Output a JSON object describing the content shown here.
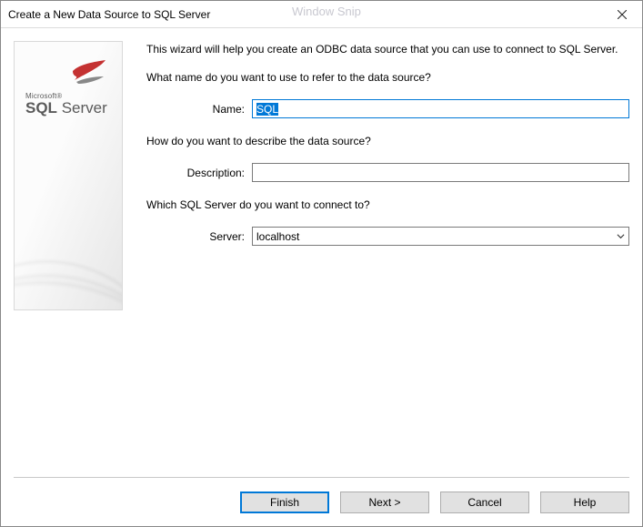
{
  "window": {
    "title": "Create a New Data Source to SQL Server",
    "snip_text": "Window Snip"
  },
  "side": {
    "brand_small": "Microsoft®",
    "brand_big_a": "SQL",
    "brand_big_b": "Server"
  },
  "intro": "This wizard will help you create an ODBC data source that you can use to connect to SQL Server.",
  "q_name": "What name do you want to use to refer to the data source?",
  "label_name": "Name:",
  "value_name": "SQL",
  "q_desc": "How do you want to describe the data source?",
  "label_desc": "Description:",
  "value_desc": "",
  "q_server": "Which SQL Server do you want to connect to?",
  "label_server": "Server:",
  "value_server": "localhost",
  "buttons": {
    "finish": "Finish",
    "next": "Next >",
    "cancel": "Cancel",
    "help": "Help"
  }
}
